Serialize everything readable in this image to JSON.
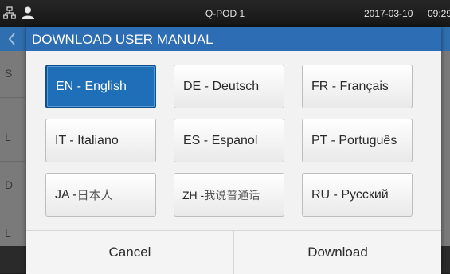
{
  "status_bar": {
    "network_icon": "network-icon",
    "user_icon": "user-icon",
    "device_name": "Q-POD 1",
    "date": "2017-03-10",
    "time": "09:29"
  },
  "background": {
    "back_icon": "chevron-left-icon",
    "rows": [
      "S",
      "L",
      "D",
      "L"
    ]
  },
  "dialog": {
    "title": "DOWNLOAD USER MANUAL",
    "languages": [
      {
        "code": "EN",
        "label": "EN - English",
        "selected": true
      },
      {
        "code": "DE",
        "label": "DE - Deutsch",
        "selected": false
      },
      {
        "code": "FR",
        "label": "FR - Français",
        "selected": false
      },
      {
        "code": "IT",
        "label": "IT - Italiano",
        "selected": false
      },
      {
        "code": "ES",
        "label": "ES - Espanol",
        "selected": false
      },
      {
        "code": "PT",
        "label": "PT - Português",
        "selected": false
      },
      {
        "code": "JA",
        "label": "JA - 日本人",
        "prefix": "JA - ",
        "native": "日本人",
        "selected": false
      },
      {
        "code": "ZH",
        "label": "ZH - 我说普通话",
        "prefix": "ZH - ",
        "native": "我说普通话",
        "selected": false
      },
      {
        "code": "RU",
        "label": "RU - Русский",
        "selected": false
      }
    ],
    "cancel_label": "Cancel",
    "download_label": "Download"
  },
  "colors": {
    "header_blue": "#2d6db3",
    "selected_blue": "#1f6fb8"
  }
}
